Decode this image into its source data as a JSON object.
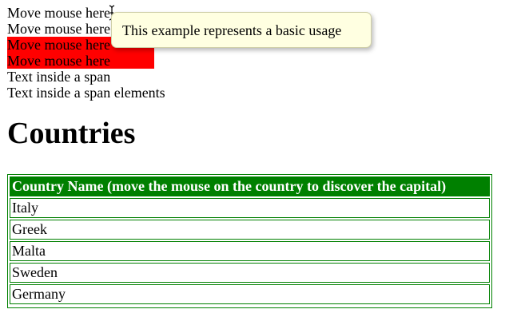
{
  "lines": [
    "Move mouse here",
    "Move mouse here",
    "Move mouse here",
    "Move mouse here",
    "Text inside a span",
    "Text inside a span elements"
  ],
  "tooltip": {
    "text": "This example represents a basic usage"
  },
  "countries": {
    "heading": "Countries",
    "table_header": "Country Name (move the mouse on the country to discover the capital)",
    "rows": [
      "Italy",
      "Greek",
      "Malta",
      "Sweden",
      "Germany"
    ]
  },
  "colors": {
    "highlight": "#ff0000",
    "table_green": "#008000",
    "tooltip_bg": "#ffffe1"
  }
}
